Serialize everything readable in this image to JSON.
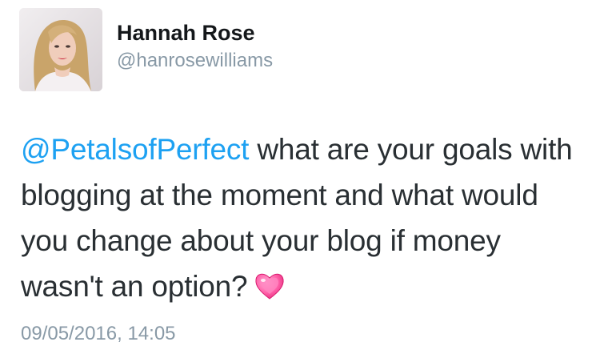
{
  "author": {
    "name": "Hannah Rose",
    "handle": "@hanrosewilliams"
  },
  "tweet": {
    "mention": "@PetalsofPerfect",
    "text": " what are your goals with blogging at the moment and what would you change about your blog if money wasn't an option?",
    "emoji_icon": "sparkling-heart-icon",
    "timestamp": "09/05/2016, 14:05"
  },
  "colors": {
    "mention": "#1da1f2",
    "secondary_text": "#8899a6",
    "heart": "#ff5fa8"
  }
}
